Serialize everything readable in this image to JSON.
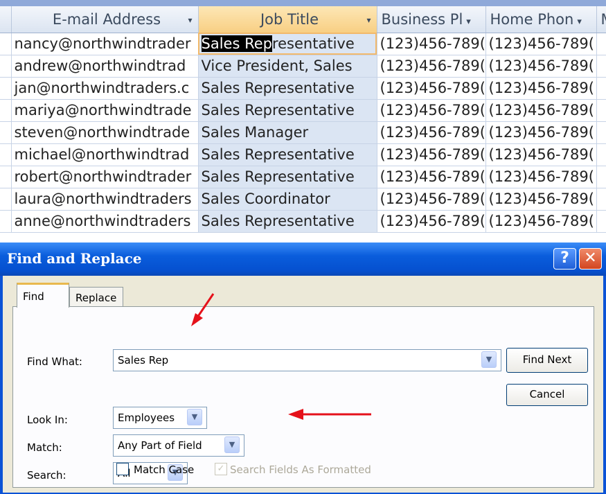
{
  "datasheet": {
    "columns": [
      {
        "label": "E-mail Address",
        "has_dropdown": true
      },
      {
        "label": "Job Title",
        "has_dropdown": true
      },
      {
        "label": "Business Pl",
        "has_dropdown": true
      },
      {
        "label": "Home Phon",
        "has_dropdown": true
      },
      {
        "label": "M",
        "has_dropdown": false
      }
    ],
    "rows": [
      {
        "email": "nancy@northwindtrader",
        "job_match": "Sales Rep",
        "job_rest": "resentative",
        "business": "(123)456-789(",
        "home": "(123)456-789("
      },
      {
        "email": "andrew@northwindtrad",
        "job": "Vice President, Sales",
        "business": "(123)456-789(",
        "home": "(123)456-789("
      },
      {
        "email": "jan@northwindtraders.c",
        "job": "Sales Representative",
        "business": "(123)456-789(",
        "home": "(123)456-789("
      },
      {
        "email": "mariya@northwindtrade",
        "job": "Sales Representative",
        "business": "(123)456-789(",
        "home": "(123)456-789("
      },
      {
        "email": "steven@northwindtrade",
        "job": "Sales Manager",
        "business": "(123)456-789(",
        "home": "(123)456-789("
      },
      {
        "email": "michael@northwindtrad",
        "job": "Sales Representative",
        "business": "(123)456-789(",
        "home": "(123)456-789("
      },
      {
        "email": "robert@northwindtrader",
        "job": "Sales Representative",
        "business": "(123)456-789(",
        "home": "(123)456-789("
      },
      {
        "email": "laura@northwindtraders",
        "job": "Sales Coordinator",
        "business": "(123)456-789(",
        "home": "(123)456-789("
      },
      {
        "email": "anne@northwindtraders",
        "job": "Sales Representative",
        "business": "(123)456-789(",
        "home": "(123)456-789("
      }
    ]
  },
  "dialog": {
    "title": "Find and Replace",
    "help_glyph": "?",
    "close_glyph": "✕",
    "tabs": {
      "find": "Find",
      "replace": "Replace"
    },
    "find_what": {
      "label": "Find What:",
      "value": "Sales Rep"
    },
    "look_in": {
      "label": "Look In:",
      "value": "Employees"
    },
    "match": {
      "label": "Match:",
      "value": "Any Part of Field"
    },
    "search": {
      "label": "Search:",
      "value": "All"
    },
    "match_case": {
      "label": "Match Case",
      "checked": false
    },
    "search_formatted": {
      "label": "Search Fields As Formatted",
      "checked": true,
      "enabled": false
    },
    "buttons": {
      "find_next": "Find Next",
      "cancel": "Cancel"
    },
    "dropdown_glyph": "▼",
    "arrow_color": "#e5111a"
  }
}
